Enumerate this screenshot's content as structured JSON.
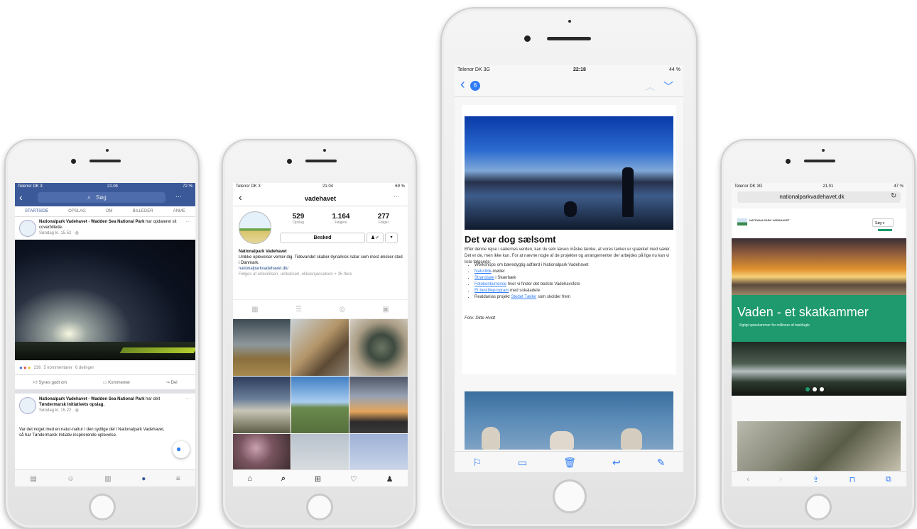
{
  "facebook": {
    "status": {
      "carrier": "Telenor DK 3",
      "time": "21.04",
      "battery": "72 %"
    },
    "search_placeholder": "Søg",
    "more_label": "···",
    "tabs": [
      "STARTSIDE",
      "OPSLAG",
      "OM",
      "BILLEDER",
      "ANME"
    ],
    "post1": {
      "author": "Nationalpark Vadehavet - Wadden Sea National Park",
      "action": "har opdateret sit coverbillede.",
      "time": "Søndag kl. 15.52 · ",
      "reactions_count": "236",
      "comments": "5 kommentarer",
      "shares": "6 delinger",
      "like_label": "Synes godt om",
      "comment_label": "Kommenter",
      "share_label": "Del"
    },
    "post2": {
      "author": "Nationalpark Vadehavet - Wadden Sea National Park",
      "action": "har delt",
      "shared_from": "Tøndermarsk Initiativets opslag.",
      "time": "Søndag kl. 15.22 · ",
      "text": "Var det noget med en natur-nattur i den sydlige del i Nationalpark Vadehavet, så har Tøndermarsk Initiativ inspirerende oplevelse."
    }
  },
  "instagram": {
    "status": {
      "carrier": "Telenor DK 3",
      "time": "21.04",
      "battery": "69 %"
    },
    "username": "vadehavet",
    "stats": [
      {
        "value": "529",
        "label": "Opslag"
      },
      {
        "value": "1.164",
        "label": "Følgere"
      },
      {
        "value": "277",
        "label": "Følger"
      }
    ],
    "follow_label": "Besked",
    "name": "Nationalpark Vadehavet",
    "bio": "Unikke oplevelser venter dig. Tidevandet skaber dynamisk natur som mest ønsker sted i Danmark.",
    "link": "nationalparkvadehavet.dk/",
    "followed_by": "Følges af erikenilsen, ulrikalisen, elikasnjaosalsen + 35 flere"
  },
  "mail": {
    "status": {
      "carrier": "Telenor DK  3G",
      "time": "22:18",
      "battery": "44 %"
    },
    "badge": "6",
    "heading": "Det var dog sælsomt",
    "intro": "Efter denne rejse i sælernes verden, kan du selv læsen måske tænke, at vores tanker er spækket med sæler. Det er de, men ikke kun. For at nævne nogle af de projekter og arrangementer der arbejdes på lige nu kan vi liste følgende:",
    "bullets": [
      {
        "link": "",
        "text": "Workshops om bæredygtig adfærd i Nationalpark Vadehavet"
      },
      {
        "link": "Naturlink",
        "text": "-møder"
      },
      {
        "link": "Strandsøe",
        "text": " i Skærbæk"
      },
      {
        "link": "Fotokonkurrence",
        "text": " hvor vi finder det bedste Vadehavsfoto"
      },
      {
        "link": "Et bestilleprogram",
        "text": " med sokaladele"
      },
      {
        "link": "",
        "text": "Realdanias projekt "
      },
      {
        "link": "Stedet Tæller",
        "text": " som skolder frem"
      }
    ],
    "credit": "Foto: Ditte Hvidt"
  },
  "web": {
    "status": {
      "carrier": "Telenor DK  3G",
      "time": "21.01",
      "battery": "47 %"
    },
    "url": "nationalparkvadehavet.dk",
    "logo_text": "NATIONALPARK VADEHAVET",
    "lang": "Søg",
    "hero_title": "Vaden - et skatkammer",
    "hero_sub": "Vigtigt spisekammer for millioner af trækfugle"
  }
}
